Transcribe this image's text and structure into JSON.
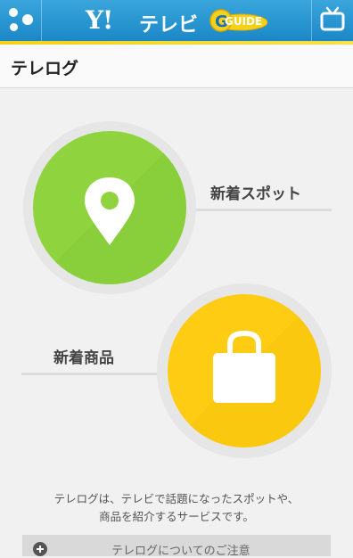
{
  "header": {
    "brand_y": "Y!",
    "brand_tv": "テレビ",
    "brand_guide": "GUIDE",
    "menu_icon": "menu-dots-icon",
    "tv_icon": "tv-icon"
  },
  "page": {
    "title": "テレログ"
  },
  "items": [
    {
      "label": "新着スポット",
      "icon": "map-pin-icon",
      "color": "#8fd43f"
    },
    {
      "label": "新着商品",
      "icon": "shopping-bag-icon",
      "color": "#ffcc14"
    }
  ],
  "description": {
    "line1": "テレログは、テレビで話題になったスポットや、",
    "line2": "商品を紹介するサービスです。"
  },
  "notice": {
    "label": "テレログについてのご注意",
    "icon": "plus-circle-icon"
  },
  "colors": {
    "header_blue": "#2196d3",
    "accent_yellow": "#f4d21a",
    "spot_green": "#8fd43f",
    "goods_yellow": "#ffcc14"
  }
}
